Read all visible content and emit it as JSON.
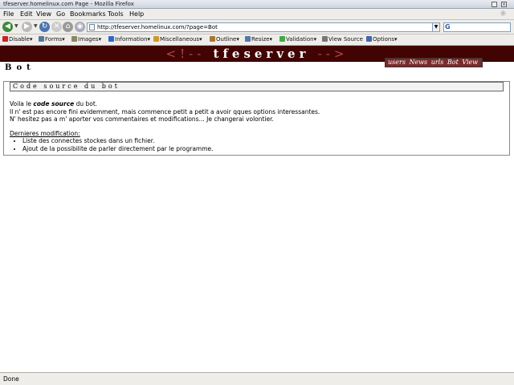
{
  "window": {
    "title": "tfeserver.homelinux.com Page - Mozilla Firefox"
  },
  "menu": [
    "File",
    "Edit",
    "View",
    "Go",
    "Bookmarks",
    "Tools",
    "Help"
  ],
  "nav": {
    "url": "http://tfeserver.homelinux.com/?page=Bot",
    "search_value": ""
  },
  "devtoolbar": [
    "Disable",
    "Forms",
    "Images",
    "Information",
    "Miscellaneous",
    "Outline",
    "Resize",
    "Validation",
    "View Source",
    "Options"
  ],
  "site": {
    "banner_left": "<!--",
    "banner_name": "tfeserver",
    "banner_right": "-->",
    "links": [
      "users",
      "News",
      "urls",
      "Bot",
      "View"
    ],
    "page_heading": "Bot"
  },
  "panel": {
    "title": "Code source du bot",
    "line1_pre": "Voila le ",
    "line1_em": "code source",
    "line1_post": " du bot.",
    "line2": "Il n' est pas encore fini evidemment, mais commence petit a petit a avoir qques options interessantes.",
    "line3": "N' hesitez pas a m' aporter vos commentaires et modifications... Je changerai volontier.",
    "mod_title": "Dernieres modification:",
    "mods": [
      "Liste des connectes stockes dans un fichier.",
      "Ajout de la possibilite de parler directement par le programme."
    ]
  },
  "status": {
    "text": "Done"
  },
  "colors": {
    "banner_bg": "#420303",
    "links_bg": "#7a2a2a"
  }
}
